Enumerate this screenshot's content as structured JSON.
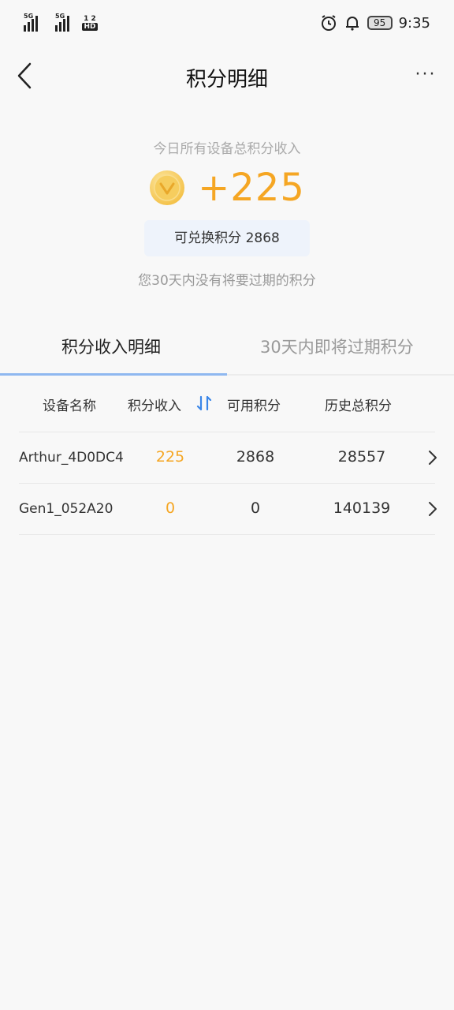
{
  "status_bar": {
    "signal_1_label": "5G",
    "signal_2_label": "5G",
    "hd_top": "1 2",
    "hd_bottom": "HD",
    "battery": "95",
    "time": "9:35"
  },
  "header": {
    "title": "积分明细",
    "more": "···"
  },
  "summary": {
    "caption": "今日所有设备总积分收入",
    "points": "+225",
    "redeem_label": "可兑换积分",
    "redeem_value": "2868",
    "expiry_note": "您30天内没有将要过期的积分"
  },
  "tabs": [
    {
      "label": "积分收入明细",
      "active": true
    },
    {
      "label": "30天内即将过期积分",
      "active": false
    }
  ],
  "table": {
    "headers": {
      "name": "设备名称",
      "income": "积分收入",
      "available": "可用积分",
      "history": "历史总积分"
    },
    "rows": [
      {
        "name": "Arthur_4D0DC4",
        "income": "225",
        "available": "2868",
        "history": "28557"
      },
      {
        "name": "Gen1_052A20",
        "income": "0",
        "available": "0",
        "history": "140139"
      }
    ]
  },
  "colors": {
    "accent_orange": "#f5a623",
    "tab_indicator": "#8fb8f0",
    "sort_icon": "#3a86e8",
    "redeem_bg": "#eef3fb"
  },
  "icons": {
    "back": "chevron-left-icon",
    "coin": "coin-icon",
    "sort": "sort-icon",
    "row_arrow": "chevron-right-icon",
    "alarm": "alarm-icon",
    "bell": "bell-icon"
  }
}
